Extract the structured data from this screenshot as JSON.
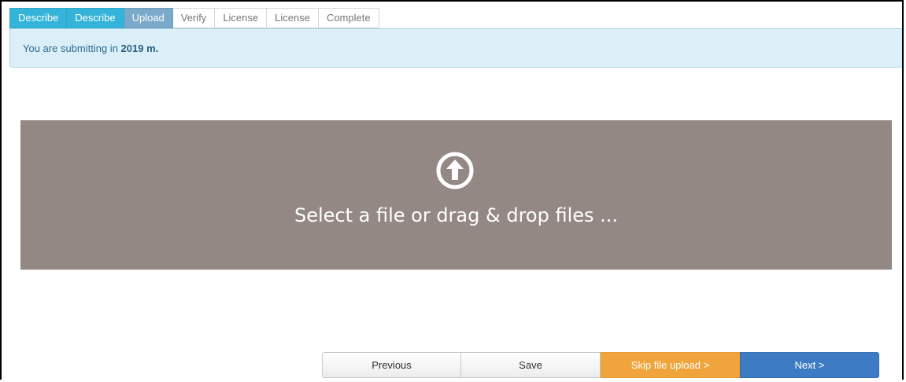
{
  "steps": [
    {
      "label": "Describe",
      "state": "done"
    },
    {
      "label": "Describe",
      "state": "done"
    },
    {
      "label": "Upload",
      "state": "current"
    },
    {
      "label": "Verify",
      "state": "todo"
    },
    {
      "label": "License",
      "state": "todo"
    },
    {
      "label": "License",
      "state": "todo"
    },
    {
      "label": "Complete",
      "state": "todo"
    }
  ],
  "alert": {
    "prefix": "You are submitting in ",
    "collection": "2019 m."
  },
  "dropzone": {
    "icon": "upload-arrow-icon",
    "text": "Select a file or drag & drop files ..."
  },
  "buttons": {
    "previous": "Previous",
    "save": "Save",
    "skip": "Skip file upload >",
    "next": "Next >"
  },
  "colors": {
    "step_done": "#34b4d8",
    "step_current": "#7aa9c9",
    "dropzone_bg": "#948885",
    "skip": "#f0a43b",
    "next": "#3d7cc4"
  }
}
